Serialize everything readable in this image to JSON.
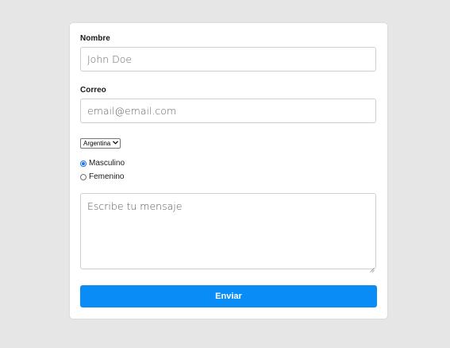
{
  "form": {
    "name_label": "Nombre",
    "name_placeholder": "John Doe",
    "email_label": "Correo",
    "email_placeholder": "email@email.com",
    "country_selected": "Argentina",
    "gender_options": [
      {
        "label": "Masculino",
        "checked": true
      },
      {
        "label": "Femenino",
        "checked": false
      }
    ],
    "message_placeholder": "Escribe tu mensaje",
    "submit_label": "Enviar"
  },
  "colors": {
    "submit_bg": "#0a8cf7",
    "page_bg": "#e6e6e6",
    "radio_accent": "#1a73e8"
  }
}
